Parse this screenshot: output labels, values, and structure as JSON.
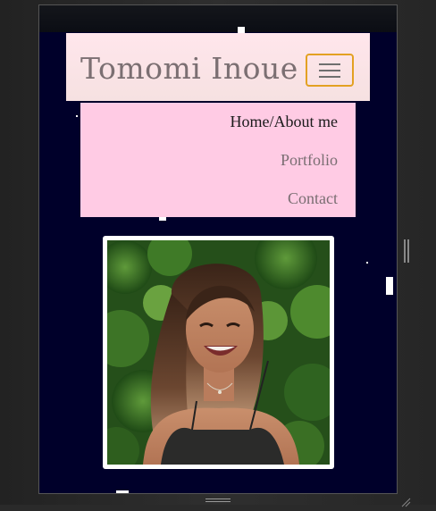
{
  "site": {
    "brand": "Tomomi Inoue"
  },
  "nav": {
    "toggle_icon": "hamburger-menu-icon",
    "items": [
      {
        "label": "Home/About me",
        "state": "active"
      },
      {
        "label": "Portfolio",
        "state": "inactive"
      },
      {
        "label": "Contact",
        "state": "inactive"
      }
    ]
  },
  "profile_photo": {
    "subject": "portrait-photo"
  },
  "colors": {
    "page_background": "#00002a",
    "navbar_background": "#ffe6ec",
    "menu_background": "#ffcbe4",
    "toggler_border": "#e3a122",
    "brand_text": "#7b6f72",
    "active_link": "#1a1a1a",
    "inactive_link": "#7a6e72"
  }
}
